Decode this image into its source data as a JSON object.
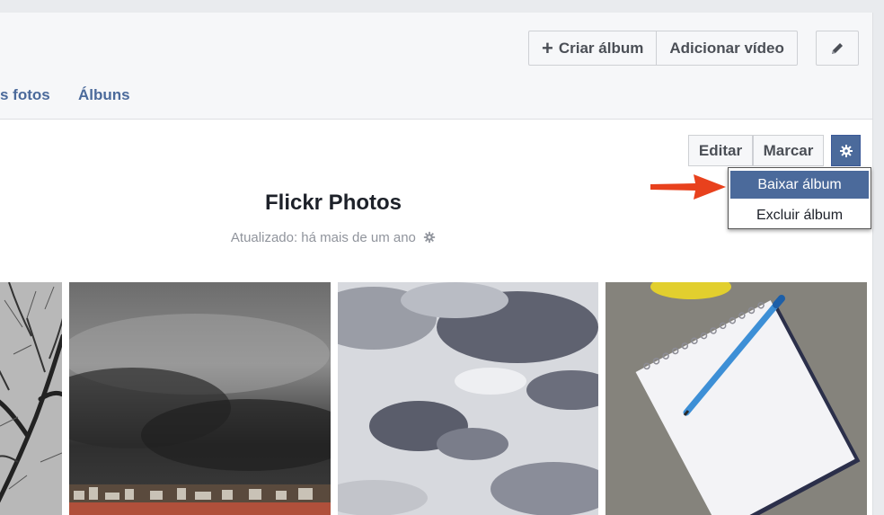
{
  "header": {
    "create_album": "Criar álbum",
    "add_video": "Adicionar vídeo"
  },
  "tabs": [
    {
      "label": "s fotos"
    },
    {
      "label": "Álbuns"
    }
  ],
  "album": {
    "title": "Flickr Photos",
    "updated": "Atualizado: há mais de um ano",
    "edit_label": "Editar",
    "tag_label": "Marcar",
    "menu": [
      {
        "label": "Baixar álbum",
        "highlighted": true
      },
      {
        "label": "Excluir álbum",
        "highlighted": false
      }
    ]
  },
  "colors": {
    "accent": "#4b6a9b",
    "arrow": "#e8411d"
  },
  "icons": {
    "pencil": "pencil-icon",
    "gear": "gear-icon",
    "plus": "plus-icon"
  }
}
